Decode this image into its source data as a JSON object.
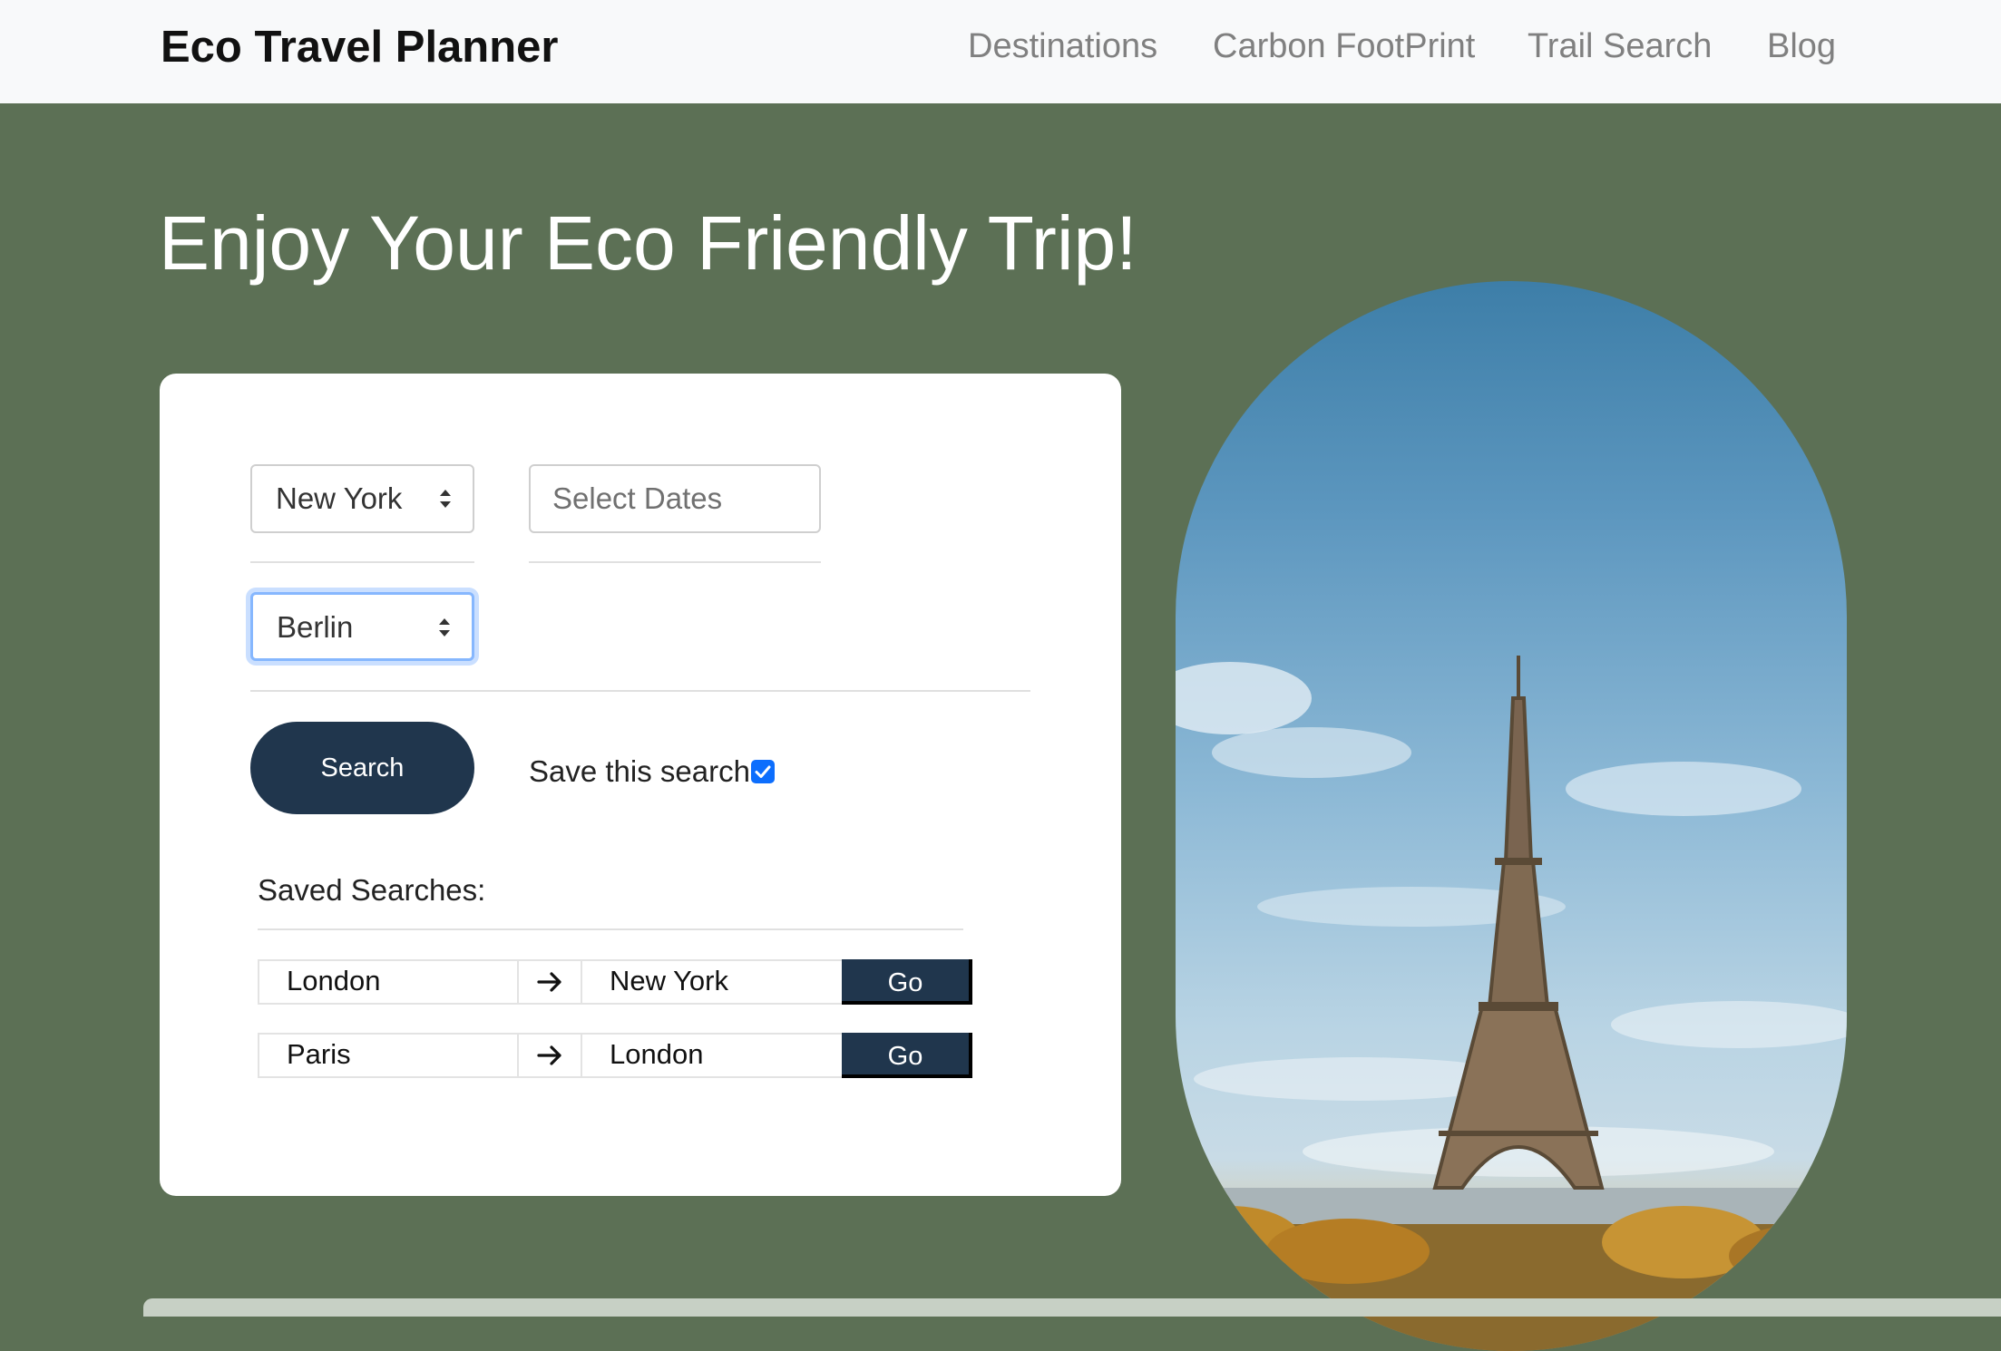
{
  "navbar": {
    "brand": "Eco Travel Planner",
    "links": [
      "Destinations",
      "Carbon FootPrint",
      "Trail Search",
      "Blog"
    ]
  },
  "hero": {
    "title": "Enjoy Your Eco Friendly Trip!"
  },
  "form": {
    "origin_value": "New York",
    "destination_value": "Berlin",
    "dates_placeholder": "Select Dates",
    "search_label": "Search",
    "save_search_label": "Save this search",
    "save_search_checked": true
  },
  "saved": {
    "title": "Saved Searches:",
    "rows": [
      {
        "from": "London",
        "to": "New York",
        "go": "Go"
      },
      {
        "from": "Paris",
        "to": "London",
        "go": "Go"
      }
    ]
  },
  "colors": {
    "page_bg": "#5c7055",
    "navbar_bg": "#f8f9fa",
    "button_bg": "#20364d",
    "accent": "#0d6efd"
  },
  "icons": {
    "select_arrows": "sort-arrows-icon",
    "row_arrow": "arrow-right-icon",
    "checkbox": "checkmark-icon"
  },
  "image": {
    "subject": "eiffel-tower-photo"
  }
}
